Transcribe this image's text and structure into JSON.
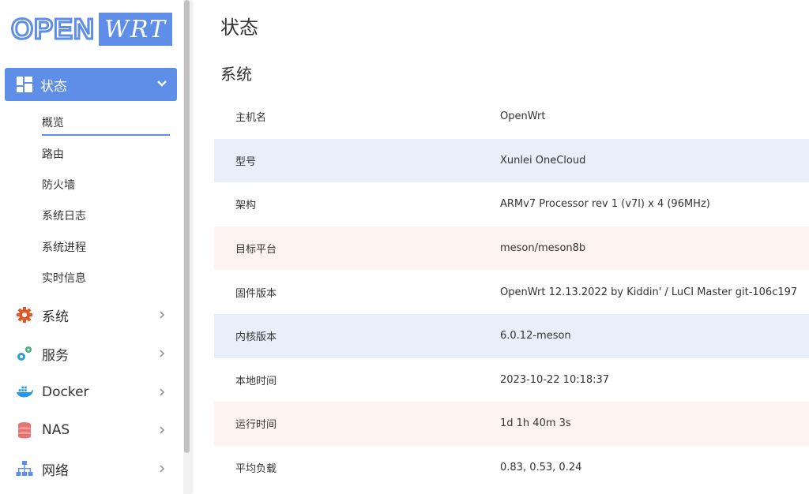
{
  "logo": {
    "left": "OPEN",
    "right": "WRT"
  },
  "sidebar": {
    "active": {
      "label": "状态"
    },
    "subitems": [
      "概览",
      "路由",
      "防火墙",
      "系统日志",
      "系统进程",
      "实时信息"
    ],
    "items": [
      {
        "label": "系统",
        "icon": "gear-icon"
      },
      {
        "label": "服务",
        "icon": "gears-icon"
      },
      {
        "label": "Docker",
        "icon": "docker-icon"
      },
      {
        "label": "NAS",
        "icon": "database-icon"
      },
      {
        "label": "网络",
        "icon": "network-icon"
      }
    ]
  },
  "main": {
    "page_title": "状态",
    "section_title": "系统",
    "rows": [
      {
        "key": "主机名",
        "value": "OpenWrt"
      },
      {
        "key": "型号",
        "value": "Xunlei OneCloud"
      },
      {
        "key": "架构",
        "value": "ARMv7 Processor rev 1 (v7l) x 4 (96MHz)"
      },
      {
        "key": "目标平台",
        "value": "meson/meson8b"
      },
      {
        "key": "固件版本",
        "value": "OpenWrt 12.13.2022 by Kiddin' / LuCI Master git-106c197"
      },
      {
        "key": "内核版本",
        "value": "6.0.12-meson"
      },
      {
        "key": "本地时间",
        "value": "2023-10-22 10:18:37"
      },
      {
        "key": "运行时间",
        "value": "1d 1h 40m 3s"
      },
      {
        "key": "平均负载",
        "value": "0.83, 0.53, 0.24"
      }
    ]
  },
  "colors": {
    "accent": "#5e8ee7",
    "row_blue": "#e8effb",
    "row_pink": "#fdf3f1"
  }
}
